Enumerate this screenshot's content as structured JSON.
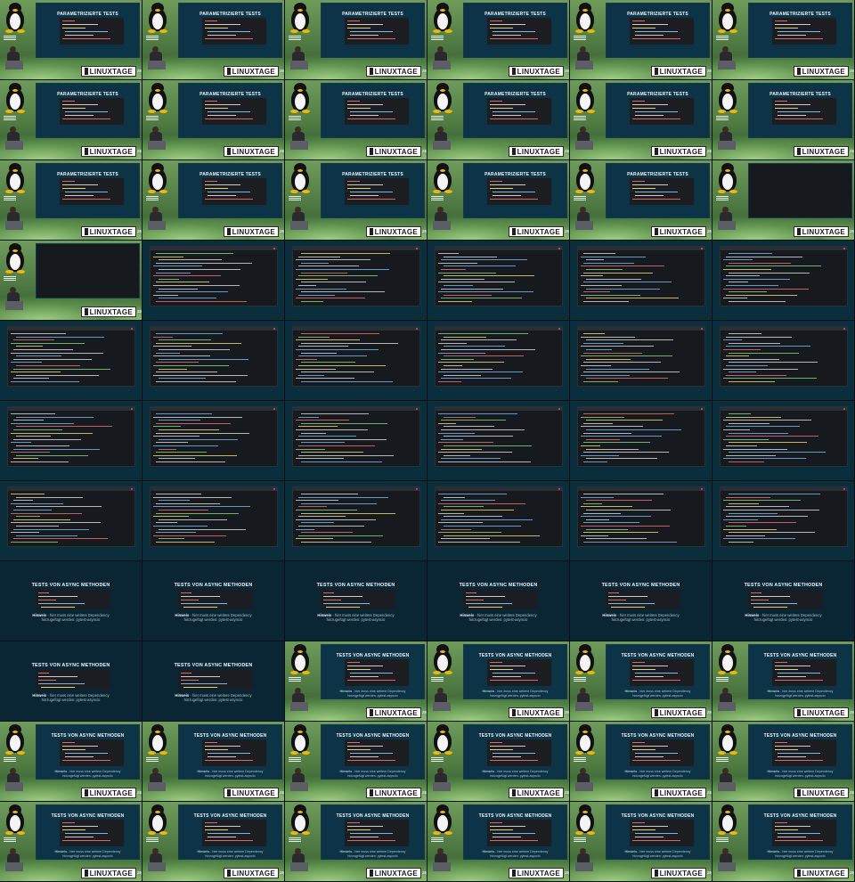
{
  "sheet": {
    "columns": 6,
    "rows": 11
  },
  "texts": {
    "conference_slide_title_param": "PARAMETRIZIERTE TESTS",
    "conference_slide_title_async": "TESTS VON ASYNC METHODEN",
    "brand": "LINUXTAGE",
    "badge": "25",
    "hint_label": "Hinweis",
    "hint_text": "- hier muss eine weitere Dependency",
    "hint_text_2": "hinzugefügt werden: pytest-asyncio"
  },
  "frames": [
    "conf-param",
    "conf-param",
    "conf-param",
    "conf-param",
    "conf-param",
    "conf-param",
    "conf-param",
    "conf-param",
    "conf-param",
    "conf-param",
    "conf-param",
    "conf-param",
    "conf-param",
    "conf-param",
    "conf-param",
    "conf-param",
    "conf-param",
    "conf-term",
    "conf-term",
    "term",
    "term",
    "term",
    "term",
    "term",
    "term",
    "term",
    "term",
    "term",
    "term",
    "term",
    "term",
    "term",
    "term",
    "term",
    "term",
    "term",
    "term",
    "term",
    "term",
    "term",
    "term",
    "term",
    "slide-async",
    "slide-async",
    "slide-async",
    "slide-async",
    "slide-async",
    "slide-async",
    "slide-async",
    "slide-async",
    "conf-async",
    "conf-async",
    "conf-async",
    "conf-async",
    "conf-async",
    "conf-async",
    "conf-async",
    "conf-async",
    "conf-async",
    "conf-async",
    "conf-async",
    "conf-async",
    "conf-async",
    "conf-async",
    "conf-async",
    "conf-async"
  ],
  "colors": {
    "slide_bg": "#0d3347",
    "stage_green": "#6f9b5c",
    "terminal_bg": "#161a1f",
    "code_red": "#d56a6a",
    "code_yellow": "#e0d27a",
    "code_blue": "#7fb6e8"
  }
}
